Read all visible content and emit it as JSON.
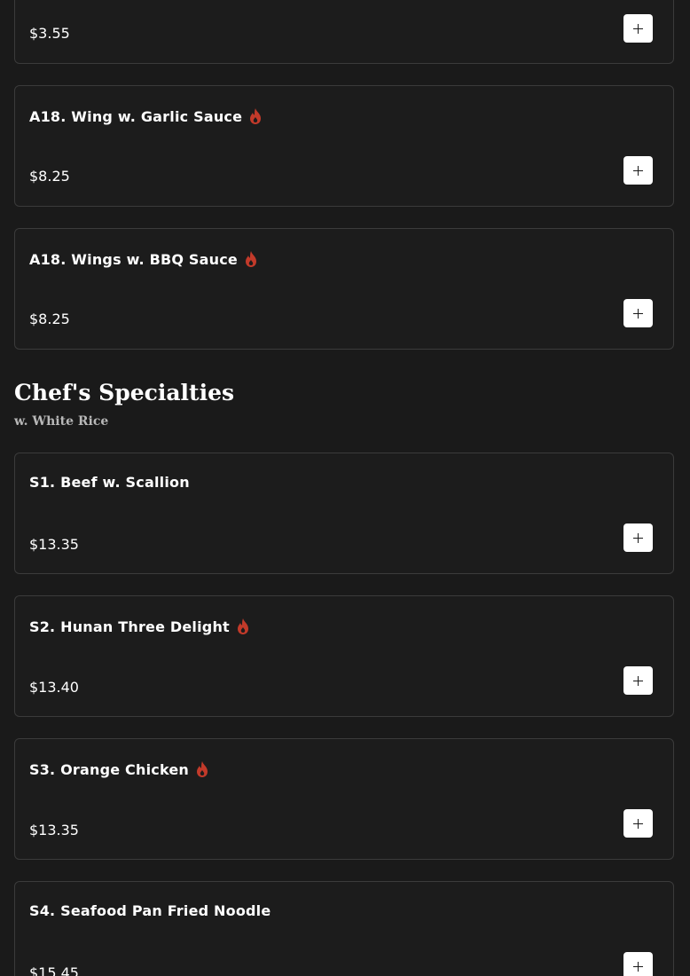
{
  "colors": {
    "background": "#1a1a1a",
    "card_border": "#3b3b3b",
    "flame": "#c23a2a",
    "button": "#ffffff"
  },
  "top_partial_item": {
    "price": "$3.55"
  },
  "appetizers": [
    {
      "name": "A18. Wing w. Garlic Sauce",
      "price": "$8.25",
      "spicy": true
    },
    {
      "name": "A18. Wings w. BBQ Sauce",
      "price": "$8.25",
      "spicy": true
    }
  ],
  "section": {
    "title": "Chef's Specialties",
    "subtitle": "w. White Rice"
  },
  "specialties": [
    {
      "name": "S1. Beef w. Scallion",
      "price": "$13.35",
      "spicy": false
    },
    {
      "name": "S2. Hunan Three Delight",
      "price": "$13.40",
      "spicy": true
    },
    {
      "name": "S3. Orange Chicken",
      "price": "$13.35",
      "spicy": true
    },
    {
      "name": "S4. Seafood Pan Fried Noodle",
      "price": "$15.45",
      "spicy": false
    }
  ]
}
